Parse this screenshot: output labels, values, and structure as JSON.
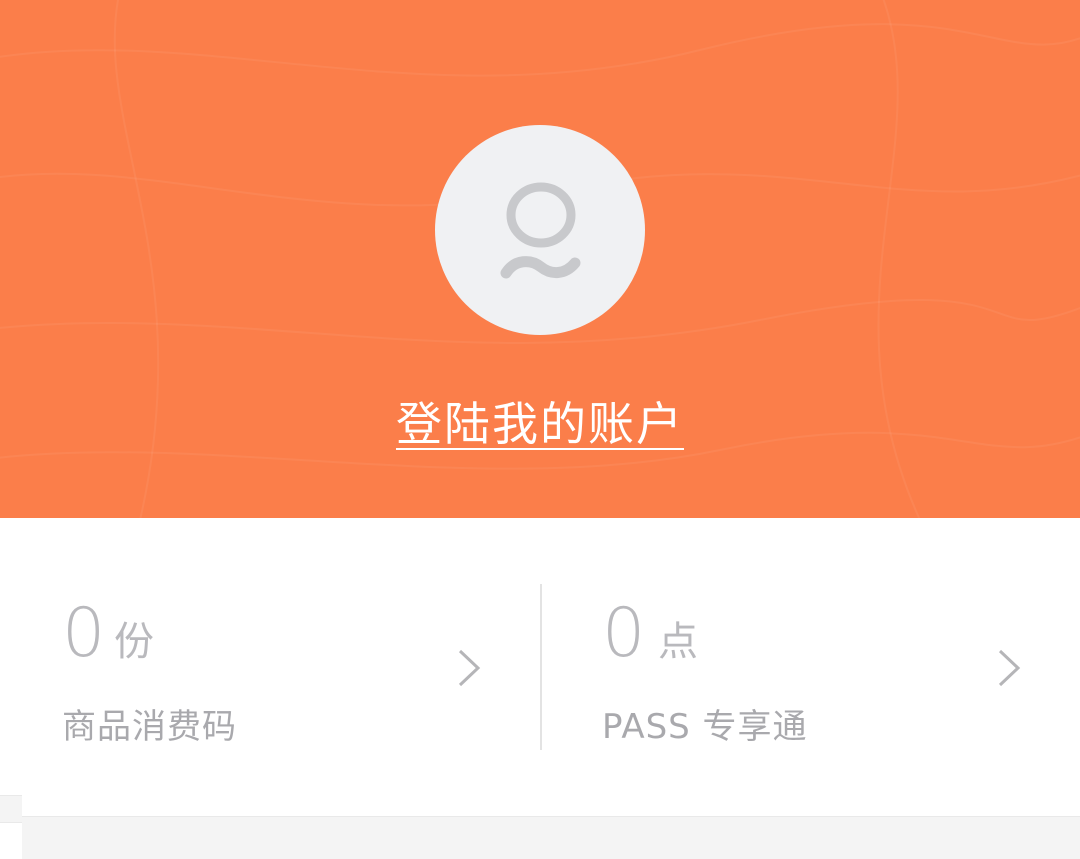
{
  "header": {
    "background_color": "#fb7e4a",
    "avatar_icon": "user-avatar-icon",
    "login_label": "登陆我的账户"
  },
  "stats": [
    {
      "value": "0",
      "unit": "份",
      "label": "商品消费码",
      "icon": "chevron-right-icon"
    },
    {
      "value": "0",
      "unit": "点",
      "label": "PASS 专享通",
      "icon": "chevron-right-icon"
    }
  ]
}
